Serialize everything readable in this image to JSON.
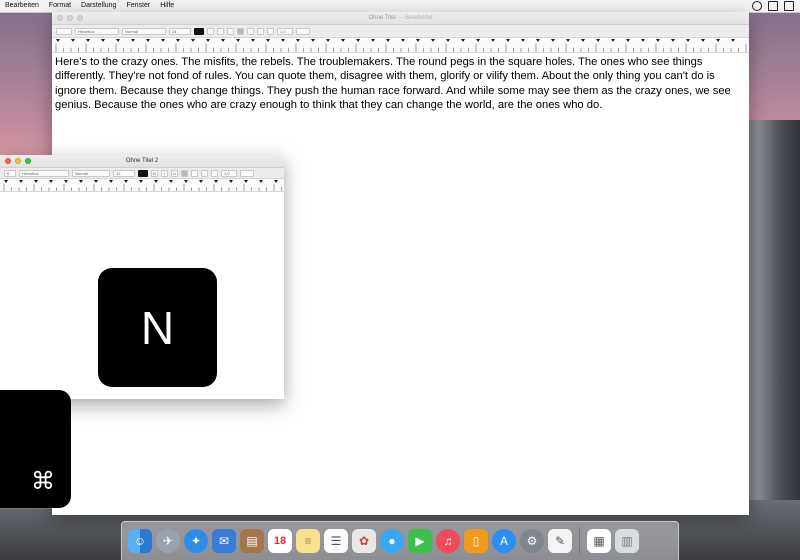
{
  "menubar": {
    "items": [
      "Bearbeiten",
      "Format",
      "Darstellung",
      "Fenster",
      "Hilfe"
    ]
  },
  "window_main": {
    "title": "Ohne Titel",
    "title_suffix": "— Bearbeitet",
    "body_text": "Here's to the crazy ones. The misfits, the rebels. The troublemakers. The round pegs in the square holes. The ones who see things differently. They're not fond of rules. You can quote them, disagree with them, glorify or vilify them. About the only thing you can't do is ignore them. Because they change things. They push the human race forward. And while some may see them as the crazy ones, we see genius. Because the ones who are crazy enough to think that they can change the world, are the ones who do.",
    "toolbar": {
      "font": "Helvetica",
      "style": "Normal",
      "size": "24",
      "spacing": "1,0"
    }
  },
  "window_second": {
    "title": "Ohne Titel 2",
    "toolbar": {
      "paragraph": "¶",
      "font": "Helvetica",
      "style": "Normal",
      "size": "12",
      "bold": "B",
      "italic": "I",
      "underline": "U",
      "spacing": "1,0"
    }
  },
  "key_overlays": {
    "letter_key": "N",
    "command_key": "⌘"
  },
  "dock": {
    "calendar_day": "18",
    "icons": [
      "finder-icon",
      "launchpad-icon",
      "safari-icon",
      "mail-icon",
      "contacts-icon",
      "calendar-icon",
      "notes-icon",
      "reminders-icon",
      "photos-icon",
      "messages-icon",
      "facetime-icon",
      "itunes-icon",
      "ibooks-icon",
      "appstore-icon",
      "system-preferences-icon",
      "textedit-icon",
      "document-icon",
      "trash-icon"
    ]
  },
  "colors": {
    "accent": "#1e7cf2",
    "key_bg": "#000000"
  }
}
